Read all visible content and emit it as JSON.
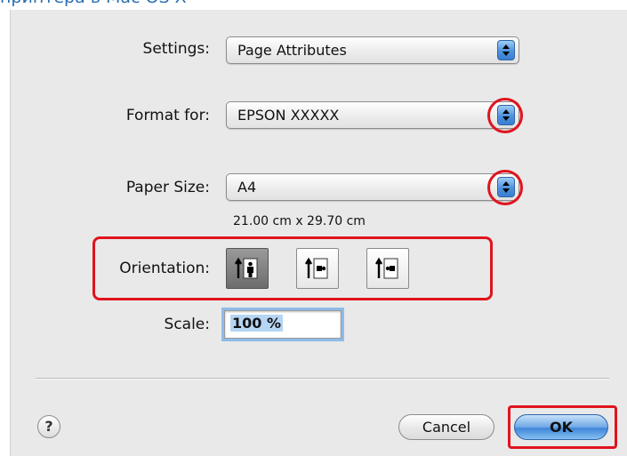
{
  "page_caption": "принтера в Mac OS X",
  "settings": {
    "label": "Settings:",
    "value": "Page Attributes"
  },
  "format_for": {
    "label": "Format for:",
    "value": "EPSON XXXXX"
  },
  "paper_size": {
    "label": "Paper Size:",
    "value": "A4",
    "dimensions": "21.00 cm x 29.70 cm"
  },
  "orientation": {
    "label": "Orientation:",
    "options": [
      {
        "name": "portrait",
        "selected": true
      },
      {
        "name": "landscape-left",
        "selected": false
      },
      {
        "name": "landscape-right",
        "selected": false
      }
    ]
  },
  "scale": {
    "label": "Scale:",
    "value": "100 %"
  },
  "buttons": {
    "help": "?",
    "cancel": "Cancel",
    "ok": "OK"
  },
  "colors": {
    "highlight": "#e0141d",
    "accent": "#3f86d8"
  }
}
